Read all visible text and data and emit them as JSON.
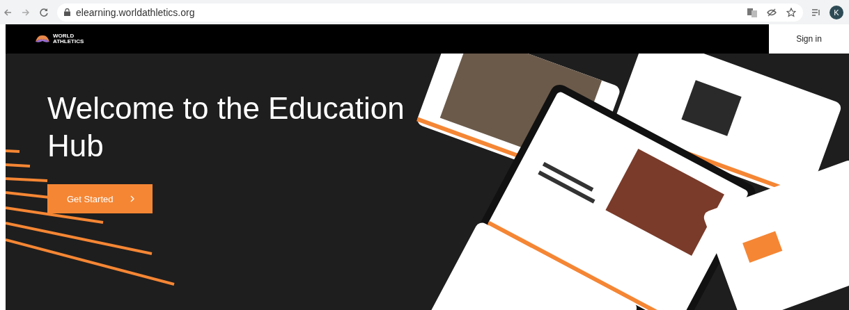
{
  "browser": {
    "url": "elearning.worldathletics.org",
    "avatar_letter": "K"
  },
  "header": {
    "logo_text": [
      "WORLD",
      "ATHLETICS"
    ],
    "sign_in": "Sign in"
  },
  "hero": {
    "title": "Welcome to the Education Hub",
    "button": "Get Started"
  }
}
